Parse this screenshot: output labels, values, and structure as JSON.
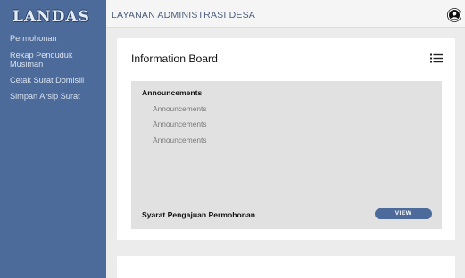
{
  "sidebar": {
    "logo": "LANDAS",
    "items": [
      {
        "label": "Permohonan"
      },
      {
        "label": "Rekap Penduduk Musiman"
      },
      {
        "label": "Cetak Surat Domisili"
      },
      {
        "label": "Simpan Arsip Surat"
      }
    ]
  },
  "header": {
    "title": "LAYANAN ADMINISTRASI DESA",
    "user_icon": "user-circle-icon"
  },
  "board": {
    "title": "Information Board",
    "menu_icon": "list-icon",
    "announcements_heading": "Announcements",
    "announcements": [
      "Announcements",
      "Announcements",
      "Announcements"
    ],
    "requirements_label": "Syarat Pengajuan Permohonan",
    "view_button": "VIEW"
  },
  "colors": {
    "sidebar": "#4d6b9a",
    "accent": "#4d6b9a",
    "background": "#ececec",
    "card": "#ffffff",
    "panel": "#e1e1e1"
  }
}
